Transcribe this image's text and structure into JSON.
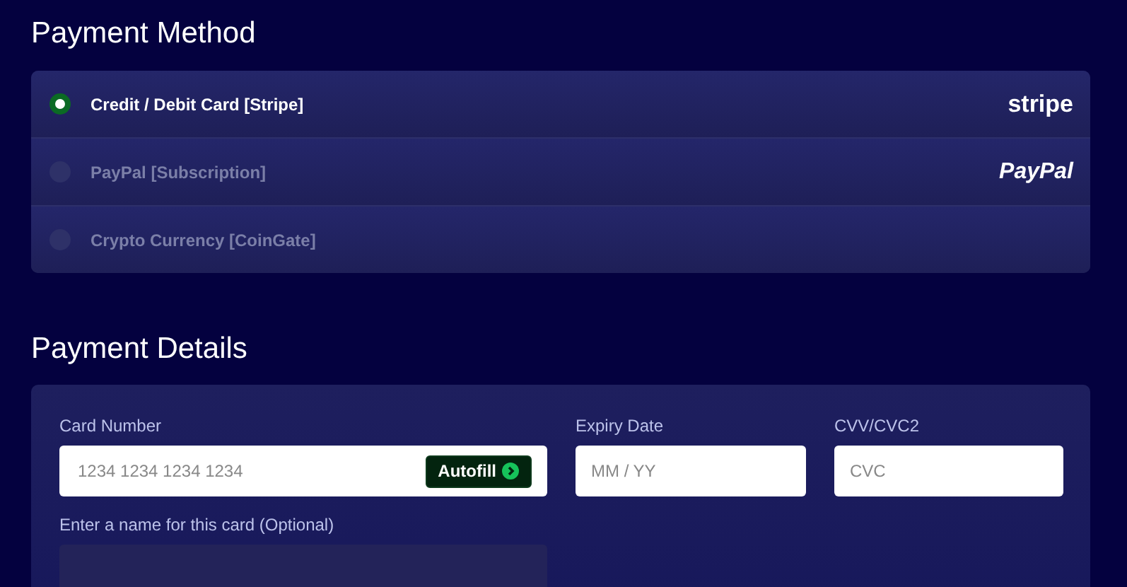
{
  "payment_method": {
    "title": "Payment Method",
    "options": [
      {
        "label": "Credit / Debit Card [Stripe]",
        "selected": true,
        "logo": "stripe",
        "kind": "stripe"
      },
      {
        "label": "PayPal [Subscription]",
        "selected": false,
        "logo": "PayPal",
        "kind": "paypal"
      },
      {
        "label": "Crypto Currency [CoinGate]",
        "selected": false
      }
    ]
  },
  "payment_details": {
    "title": "Payment Details",
    "card_number": {
      "label": "Card Number",
      "placeholder": "1234 1234 1234 1234",
      "autofill": "Autofill"
    },
    "expiry": {
      "label": "Expiry Date",
      "placeholder": "MM / YY"
    },
    "cvv": {
      "label": "CVV/CVC2",
      "placeholder": "CVC"
    },
    "card_name": {
      "label": "Enter a name for this card (Optional)"
    }
  }
}
